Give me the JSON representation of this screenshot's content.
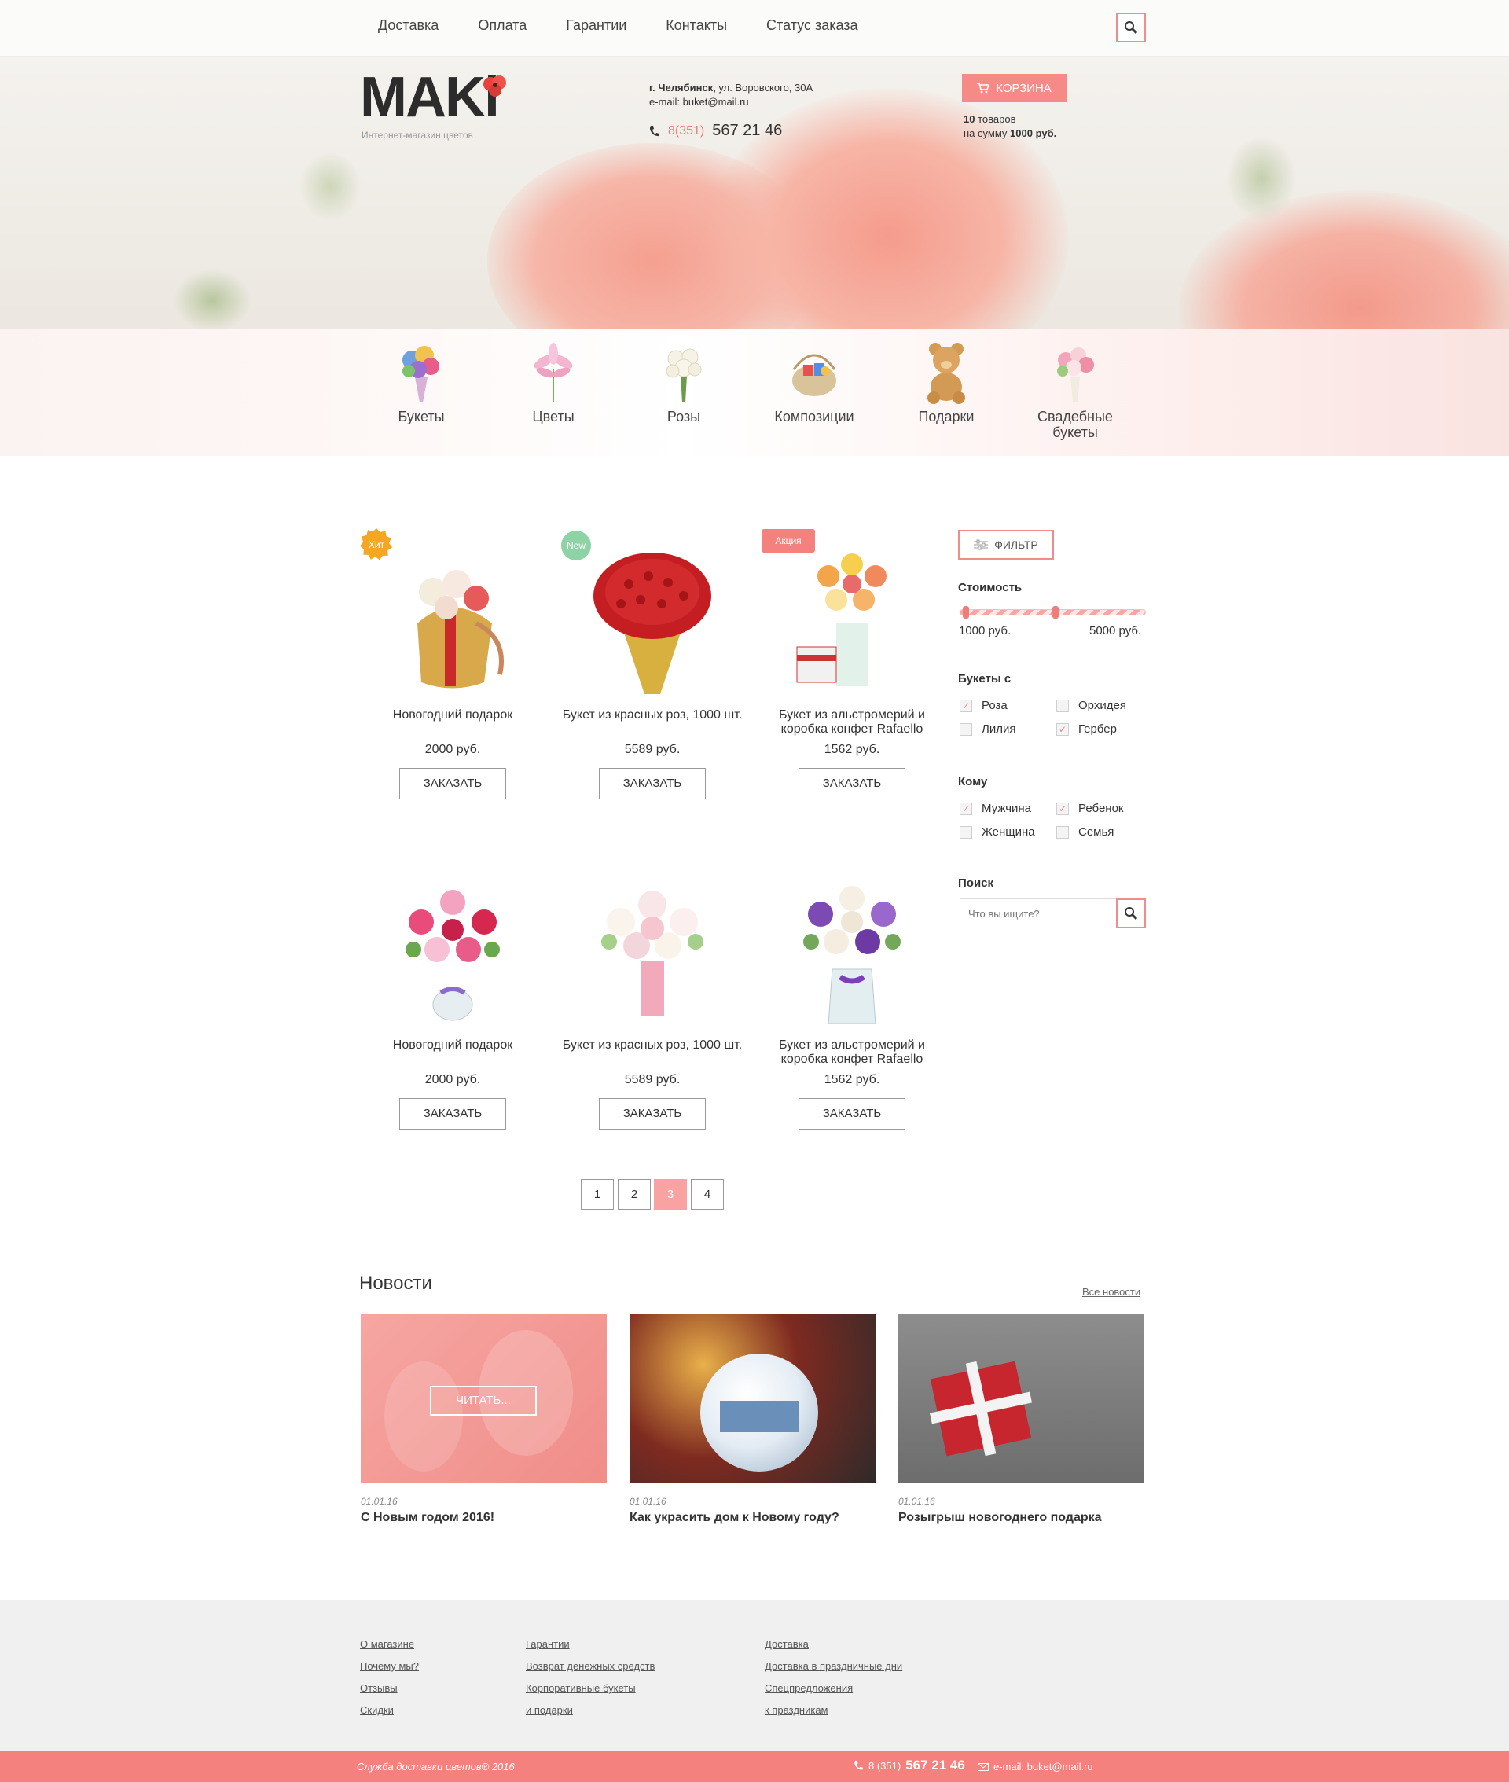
{
  "topnav": {
    "items": [
      "Доставка",
      "Оплата",
      "Гарантии",
      "Контакты",
      "Статус заказа"
    ]
  },
  "header": {
    "logo": "MAKi",
    "tagline": "Интернет-магазин цветов",
    "city": "г. Челябинск,",
    "address": "ул. Воровского, 30А",
    "email": "e-mail: buket@mail.ru",
    "phone_code": "8(351)",
    "phone_number": "567 21 46",
    "cart_label": "КОРЗИНА",
    "cart_count": "10",
    "cart_count_suffix": "товаров",
    "cart_sum_prefix": "на сумму",
    "cart_sum": "1000 руб."
  },
  "categories": [
    {
      "label": "Букеты",
      "icon": "bouquet-icon"
    },
    {
      "label": "Цветы",
      "icon": "lily-icon"
    },
    {
      "label": "Розы",
      "icon": "roses-icon"
    },
    {
      "label": "Композиции",
      "icon": "basket-icon"
    },
    {
      "label": "Подарки",
      "icon": "teddy-bear-icon"
    },
    {
      "label": "Свадебные букеты",
      "icon": "wedding-bouquet-icon"
    }
  ],
  "products": [
    {
      "name": "Новогодний подарок",
      "price": "2000 руб.",
      "button": "ЗАКАЗАТЬ",
      "badge": "Хит"
    },
    {
      "name": "Букет из красных роз, 1000 шт.",
      "price": "5589 руб.",
      "button": "ЗАКАЗАТЬ",
      "badge": "New"
    },
    {
      "name": "Букет из альстромерий и коробка конфет Rafaello",
      "price": "1562 руб.",
      "button": "ЗАКАЗАТЬ",
      "badge": "Акция"
    },
    {
      "name": "Новогодний подарок",
      "price": "2000 руб.",
      "button": "ЗАКАЗАТЬ",
      "badge": ""
    },
    {
      "name": "Букет из красных роз, 1000 шт.",
      "price": "5589 руб.",
      "button": "ЗАКАЗАТЬ",
      "badge": ""
    },
    {
      "name": "Букет из альстромерий и коробка конфет Rafaello",
      "price": "1562 руб.",
      "button": "ЗАКАЗАТЬ",
      "badge": ""
    }
  ],
  "filter": {
    "button": "ФИЛЬТР",
    "cost_title": "Стоимость",
    "price_min": "1000 руб.",
    "price_max": "5000 руб.",
    "price_range_fraction": [
      0.0,
      0.5
    ],
    "bouquets_title": "Букеты с",
    "bouquets": [
      {
        "label": "Роза",
        "checked": true
      },
      {
        "label": "Орхидея",
        "checked": false
      },
      {
        "label": "Лилия",
        "checked": false
      },
      {
        "label": "Гербер",
        "checked": true
      }
    ],
    "whom_title": "Кому",
    "whom": [
      {
        "label": "Мужчина",
        "checked": true
      },
      {
        "label": "Ребенок",
        "checked": true
      },
      {
        "label": "Женщина",
        "checked": false
      },
      {
        "label": "Семья",
        "checked": false
      }
    ],
    "search_title": "Поиск",
    "search_placeholder": "Что вы ищите?"
  },
  "pagination": {
    "pages": [
      "1",
      "2",
      "3",
      "4"
    ],
    "active": "3"
  },
  "news": {
    "title": "Новости",
    "all_link": "Все новости",
    "read_button": "ЧИТАТЬ...",
    "items": [
      {
        "date": "01.01.16",
        "title": "С Новым годом 2016!"
      },
      {
        "date": "01.01.16",
        "title": "Как украсить дом к Новому году?"
      },
      {
        "date": "01.01.16",
        "title": "Розыгрыш новогоднего подарка"
      }
    ]
  },
  "footer": {
    "col1": [
      "О магазине",
      "Почему мы?",
      "Отзывы",
      "Скидки"
    ],
    "col2": [
      "Гарантии",
      "Возврат денежных средств",
      "Корпоративные букеты",
      "и подарки"
    ],
    "col3": [
      "Доставка",
      "Доставка в праздничные дни",
      "Спецпредложения",
      "к праздникам"
    ],
    "copyright": "Служба доставки цветов® 2016",
    "phone_code": "8 (351)",
    "phone_number": "567 21 46",
    "email": "e-mail: buket@mail.ru"
  },
  "colors": {
    "accent": "#f4817e",
    "accent_light": "#f8a3a1",
    "badge_orange": "#f5a623",
    "badge_green": "#8dd3a6"
  }
}
